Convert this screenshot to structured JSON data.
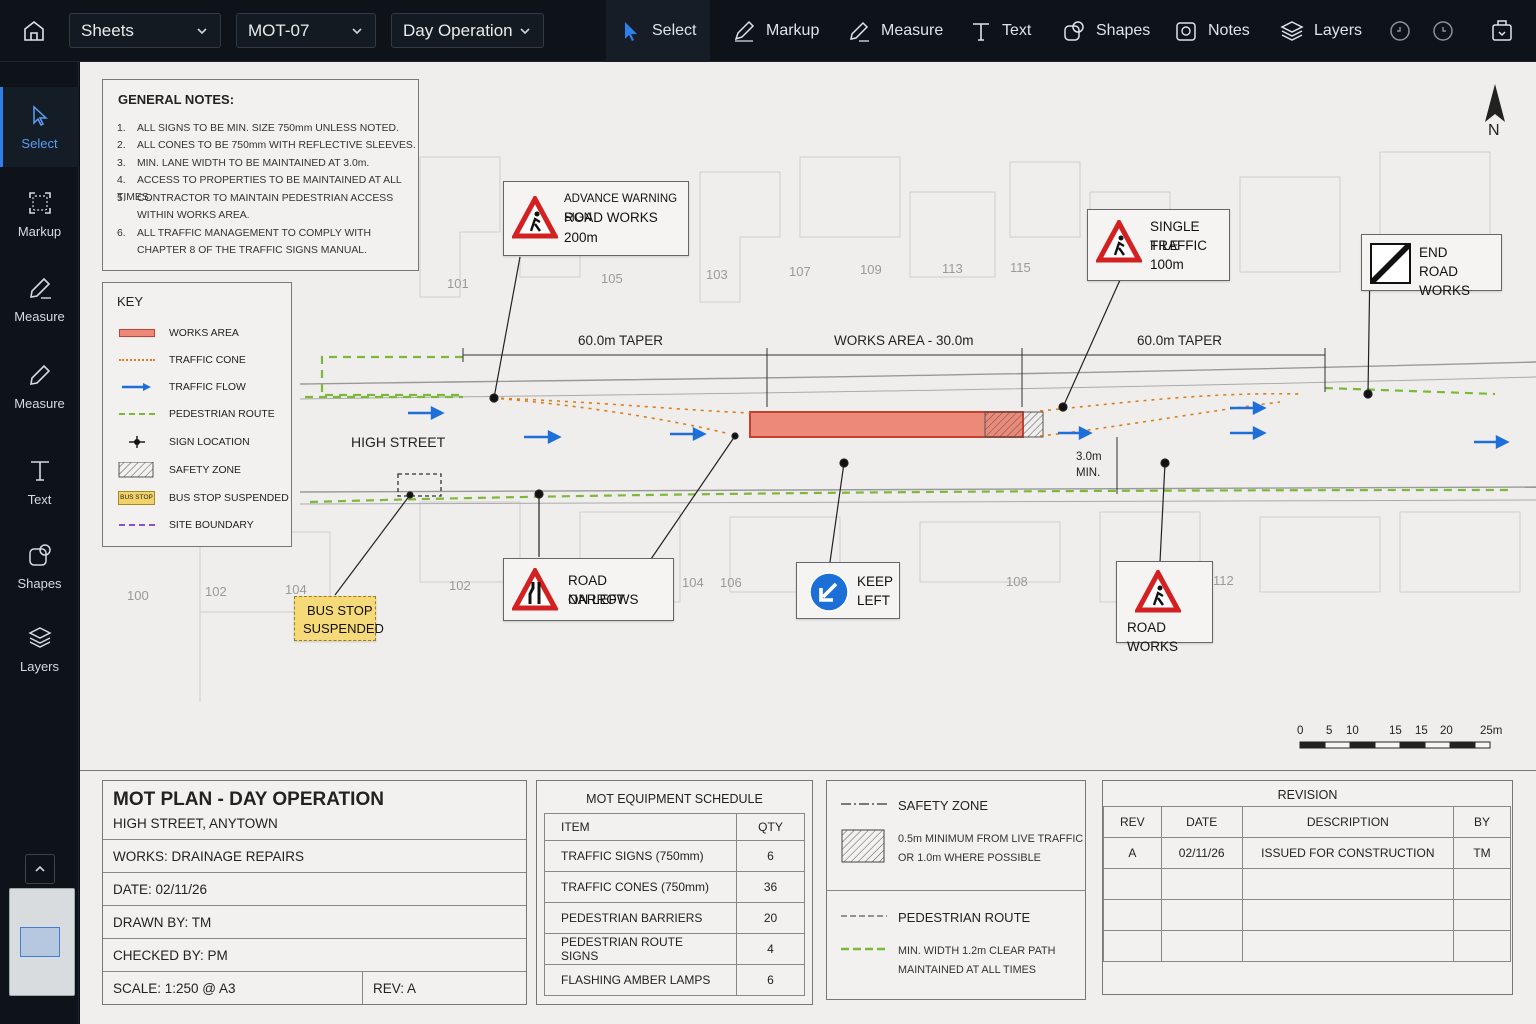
{
  "toolbar": {
    "dropdowns": [
      "Sheets",
      "MOT-07",
      "Day Operation"
    ],
    "tools": [
      "Select",
      "Markup",
      "Measure",
      "Text",
      "Shapes",
      "Notes",
      "Layers"
    ]
  },
  "sidebar": {
    "items": [
      "Select",
      "Markup",
      "Measure",
      "Measure",
      "Text",
      "Shapes",
      "Layers"
    ]
  },
  "drawing": {
    "general_notes": {
      "title": "GENERAL NOTES:",
      "items": [
        {
          "num": "1.",
          "text": "ALL SIGNS TO BE MIN. SIZE 750mm UNLESS NOTED."
        },
        {
          "num": "2.",
          "text": "ALL CONES TO BE 750mm WITH REFLECTIVE SLEEVES."
        },
        {
          "num": "3.",
          "text": "MIN. LANE WIDTH TO BE MAINTAINED AT 3.0m."
        },
        {
          "num": "4.",
          "text": "ACCESS TO PROPERTIES TO BE MAINTAINED AT ALL TIMES."
        },
        {
          "num": "5.",
          "text": "CONTRACTOR TO MAINTAIN PEDESTRIAN ACCESS"
        },
        {
          "num": "",
          "text": "WITHIN WORKS AREA."
        },
        {
          "num": "6.",
          "text": "ALL TRAFFIC MANAGEMENT TO COMPLY WITH"
        },
        {
          "num": "",
          "text": "CHAPTER 8 OF THE TRAFFIC SIGNS MANUAL."
        }
      ]
    },
    "key": {
      "title": "KEY",
      "items": [
        "WORKS AREA",
        "TRAFFIC CONE",
        "TRAFFIC FLOW",
        "PEDESTRIAN ROUTE",
        "SIGN LOCATION",
        "SAFETY ZONE",
        "BUS STOP SUSPENDED",
        "SITE BOUNDARY"
      ],
      "bus_stop_badge": "BUS STOP"
    },
    "signs": {
      "advance": {
        "l1": "ADVANCE WARNING SIGN",
        "l2": "ROAD WORKS",
        "l3": "200m"
      },
      "single_file": {
        "l1": "SINGLE FILE",
        "l2": "TRAFFIC",
        "l3": "100m"
      },
      "end": {
        "l1": "END",
        "l2": "ROAD WORKS"
      },
      "narrows": {
        "l1": "ROAD NARROWS",
        "l2": "ON LEFT"
      },
      "keep_left": {
        "l1": "KEEP",
        "l2": "LEFT"
      },
      "road_works": {
        "l1": "ROAD WORKS"
      },
      "bus_stop": {
        "l1": "BUS STOP",
        "l2": "SUSPENDED"
      }
    },
    "dimensions": {
      "taper_left": "60.0m TAPER",
      "works": "WORKS AREA - 30.0m",
      "taper_right": "60.0m TAPER",
      "lane_min_1": "3.0m",
      "lane_min_2": "MIN."
    },
    "street_name": "HIGH STREET",
    "lots": [
      "101",
      "105",
      "103",
      "107",
      "109",
      "113",
      "115",
      "100",
      "102",
      "104",
      "102",
      "104",
      "106",
      "108",
      "112"
    ],
    "north": "N",
    "scale_labels": [
      "0",
      "5",
      "10",
      "15",
      "15",
      "20",
      "25m"
    ],
    "colors": {
      "accent": "#2f7fe8",
      "works": "#e8705e",
      "cone": "#e07b1a",
      "ped": "#7cb83a",
      "boundary": "#8a4fd8",
      "flow": "#1e6fd9"
    }
  },
  "title_block": {
    "title": "MOT PLAN - DAY OPERATION",
    "location": "HIGH STREET, ANYTOWN",
    "works": "WORKS: DRAINAGE REPAIRS",
    "date": "DATE: 02/11/26",
    "drawn": "DRAWN BY: TM",
    "checked": "CHECKED BY: PM",
    "scale": "SCALE: 1:250 @ A3",
    "rev": "REV: A"
  },
  "schedule": {
    "title": "MOT EQUIPMENT SCHEDULE",
    "headers": [
      "ITEM",
      "QTY"
    ],
    "rows": [
      [
        "TRAFFIC SIGNS (750mm)",
        "6"
      ],
      [
        "TRAFFIC CONES (750mm)",
        "36"
      ],
      [
        "PEDESTRIAN BARRIERS",
        "20"
      ],
      [
        "PEDESTRIAN ROUTE SIGNS",
        "4"
      ],
      [
        "FLASHING AMBER LAMPS",
        "6"
      ]
    ]
  },
  "legend": {
    "safety_title": "SAFETY ZONE",
    "safety_l1": "0.5m MINIMUM FROM LIVE TRAFFIC",
    "safety_l2": "OR 1.0m WHERE POSSIBLE",
    "ped_title": "PEDESTRIAN ROUTE",
    "ped_l1": "MIN. WIDTH 1.2m CLEAR PATH",
    "ped_l2": "MAINTAINED AT ALL TIMES"
  },
  "revision": {
    "title": "REVISION",
    "headers": [
      "REV",
      "DATE",
      "DESCRIPTION",
      "BY"
    ],
    "rows": [
      [
        "A",
        "02/11/26",
        "ISSUED FOR CONSTRUCTION",
        "TM"
      ]
    ]
  }
}
